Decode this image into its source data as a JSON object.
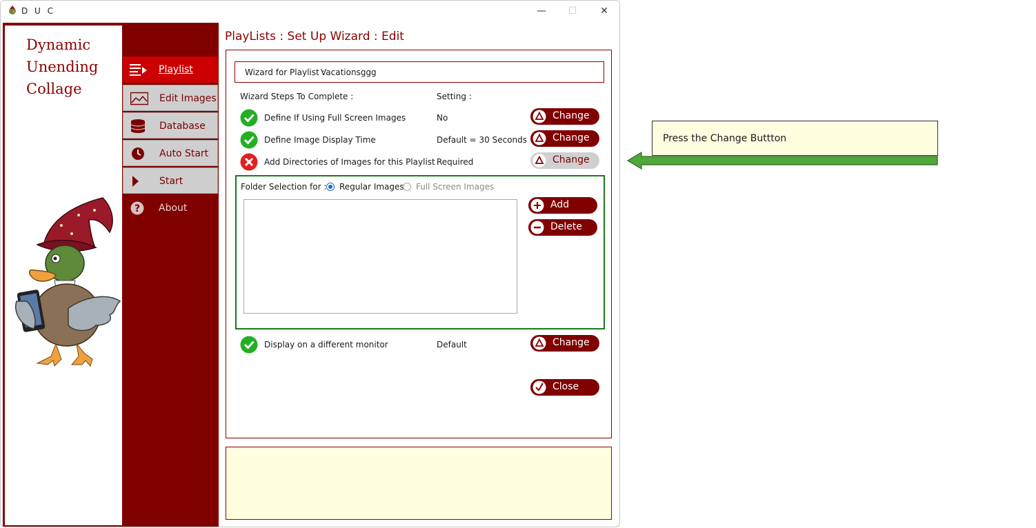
{
  "window": {
    "title": "D U C",
    "minimize": "—",
    "maximize": "☐",
    "close": "✕"
  },
  "logo": {
    "line1": "Dynamic",
    "line2": "Unending",
    "line3": "Collage"
  },
  "nav": [
    {
      "label": "Playlist"
    },
    {
      "label": "Edit Images"
    },
    {
      "label": "Database"
    },
    {
      "label": "Auto Start"
    },
    {
      "label": "Start"
    },
    {
      "label": "About"
    }
  ],
  "page": {
    "title": "PlayLists : Set Up Wizard : Edit",
    "wizard_for_label": "Wizard for Playlist :",
    "playlist_name": "Vacationsggg",
    "steps_header": "Wizard Steps To Complete :",
    "setting_header": "Setting :",
    "steps": [
      {
        "label": "Define If Using Full Screen Images",
        "value": "No",
        "status": "complete",
        "button": "Change"
      },
      {
        "label": "Define Image Display Time",
        "value": "Default = 30 Seconds",
        "status": "complete",
        "button": "Change"
      },
      {
        "label": "Add Directories of Images for this Playlist",
        "value": "Required",
        "status": "incomplete",
        "button": "Change"
      }
    ],
    "folder": {
      "label": "Folder Selection for :",
      "option_regular": "Regular Images",
      "option_full": "Full Screen Images",
      "selected": "Regular Images",
      "add": "Add",
      "delete": "Delete"
    },
    "monitor_step": {
      "label": "Display on a different monitor",
      "value": "Default",
      "status": "complete",
      "button": "Change"
    },
    "close": "Close"
  },
  "callout": {
    "text": "Press the Change Buttton"
  },
  "colors": {
    "brand": "#800000",
    "active": "#cc0000",
    "success": "#22b022",
    "error": "#e02020",
    "note": "#ffffe0",
    "arrow": "#4fa83a"
  }
}
